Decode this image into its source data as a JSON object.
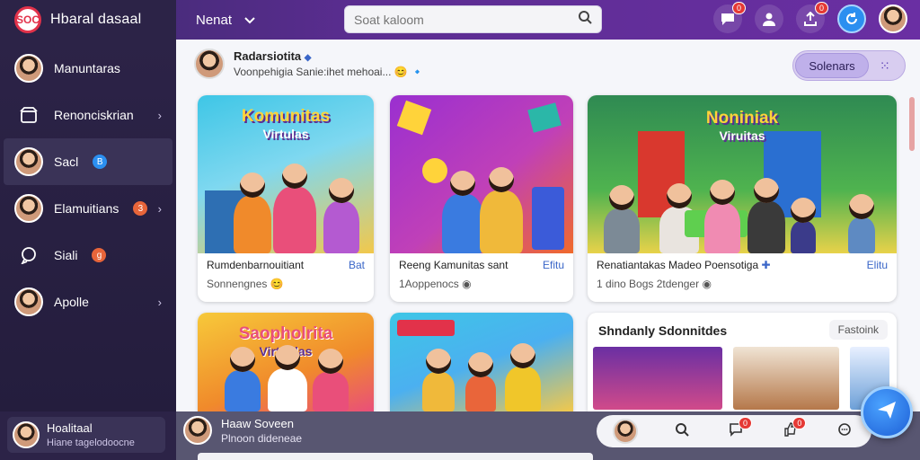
{
  "app": {
    "title": "Hbaral dasaal",
    "logo_text": "SOC"
  },
  "topbar": {
    "nav_label": "Nenat",
    "search_placeholder": "Soat kaloom",
    "badges": {
      "messages": "0",
      "uploads": "0"
    }
  },
  "sidebar": {
    "items": [
      {
        "label": "Manuntaras"
      },
      {
        "label": "Renonciskrian"
      },
      {
        "label": "Sacl",
        "chip": "B"
      },
      {
        "label": "Elamuitians",
        "chip": "3"
      },
      {
        "label": "Siali",
        "chip": "g"
      },
      {
        "label": "Apolle"
      }
    ]
  },
  "feed": {
    "author": "Radarsiotita",
    "status": "Voonpehigia Sanie:ihet mehoai...",
    "filter_button": "Solenars"
  },
  "cards": [
    {
      "thumb_title": "Komunitas",
      "thumb_subtitle": "Virtulas",
      "caption": "Rumdenbarnouitiant",
      "link": "Bat",
      "meta": "Sonnengnes"
    },
    {
      "caption": "Reeng Kamunitas sant",
      "link": "Efitu",
      "meta": "1Aoppenocs"
    },
    {
      "thumb_title": "Noniniak",
      "thumb_subtitle": "Viruitas",
      "caption": "Renatiantakas Madeo Poensotiga",
      "link": "Elitu",
      "meta": "1 dino Bogs 2tdenger"
    },
    {
      "thumb_title": "Saopholrita",
      "thumb_subtitle": "Virtualas"
    },
    {},
    {
      "title": "Shndanly Sdonnitdes",
      "action": "Fastoink"
    }
  ],
  "bottombar": {
    "user_name": "Hoalitaal",
    "user_sub": "Hiane tagelodoocne",
    "chat_name": "Haaw Soveen",
    "chat_sub": "Plnoon dideneae",
    "badges": {
      "comments": "0",
      "likes": "0"
    }
  }
}
